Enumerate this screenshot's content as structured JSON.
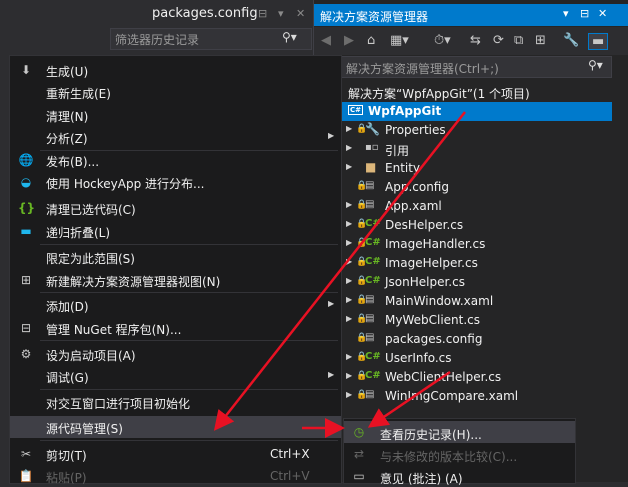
{
  "doc_tab": {
    "title": "packages.config",
    "pin": "⊟",
    "dropdown": "▾",
    "close": "✕"
  },
  "filter": {
    "placeholder": "筛选器历史记录",
    "icon": "⚲▾"
  },
  "context_menu": {
    "items": [
      {
        "label": "生成(U)",
        "icon": "build-icon",
        "glyph": "⬇"
      },
      {
        "label": "重新生成(E)"
      },
      {
        "label": "清理(N)"
      },
      {
        "label": "分析(Z)",
        "submenu": true
      },
      {
        "label": "发布(B)...",
        "icon": "globe-icon",
        "glyph": "🌐"
      },
      {
        "label": "使用 HockeyApp 进行分布...",
        "icon": "hockeyapp-icon",
        "glyph": "◒"
      },
      {
        "label": "清理已选代码(C)",
        "icon": "braces-icon",
        "glyph": "{}"
      },
      {
        "label": "递归折叠(L)",
        "icon": "collapse-icon",
        "glyph": "▬"
      },
      {
        "label": "限定为此范围(S)"
      },
      {
        "label": "新建解决方案资源管理器视图(N)",
        "icon": "new-view-icon",
        "glyph": "⊞"
      },
      {
        "label": "添加(D)",
        "submenu": true
      },
      {
        "label": "管理 NuGet 程序包(N)...",
        "icon": "nuget-icon",
        "glyph": "⊟"
      },
      {
        "label": "设为启动项目(A)",
        "icon": "gear-icon",
        "glyph": "⚙"
      },
      {
        "label": "调试(G)",
        "submenu": true
      },
      {
        "label": "对交互窗口进行项目初始化"
      },
      {
        "label": "源代码管理(S)",
        "submenu": true,
        "highlighted": true
      },
      {
        "label": "剪切(T)",
        "icon": "scissors-icon",
        "glyph": "✂",
        "shortcut": "Ctrl+X"
      },
      {
        "label": "粘贴(P)",
        "icon": "paste-icon",
        "glyph": "📋",
        "shortcut": "Ctrl+V",
        "disabled": true
      }
    ]
  },
  "solution_explorer": {
    "title": "解决方案资源管理器",
    "title_buttons": [
      "▾",
      "⊟",
      "✕"
    ],
    "toolbar": [
      "◀",
      "▶",
      "⌂",
      "▦▾",
      "⏱▾",
      "⇆",
      "⟳",
      "⧉",
      "⊞",
      "🔧",
      "▬"
    ],
    "search_placeholder": "解决方案资源管理器(Ctrl+;)",
    "search_icon": "⚲▾",
    "tree": [
      {
        "label": "解决方案“WpfAppGit”(1 个项目)",
        "indent": 0,
        "kind": "solution"
      },
      {
        "label": "WpfAppGit",
        "indent": 0,
        "kind": "project",
        "selected": true
      },
      {
        "label": "Properties",
        "indent": 1,
        "kind": "wrench",
        "expandable": true,
        "locked": true
      },
      {
        "label": "引用",
        "indent": 1,
        "kind": "refs",
        "expandable": true
      },
      {
        "label": "Entity",
        "indent": 1,
        "kind": "folder",
        "expandable": true
      },
      {
        "label": "App.config",
        "indent": 1,
        "kind": "config",
        "locked": true
      },
      {
        "label": "App.xaml",
        "indent": 1,
        "kind": "xaml",
        "expandable": true,
        "locked": true
      },
      {
        "label": "DesHelper.cs",
        "indent": 1,
        "kind": "cs",
        "expandable": true,
        "locked": true
      },
      {
        "label": "ImageHandler.cs",
        "indent": 1,
        "kind": "cs",
        "expandable": true,
        "locked": true
      },
      {
        "label": "ImageHelper.cs",
        "indent": 1,
        "kind": "cs",
        "expandable": true,
        "locked": true
      },
      {
        "label": "JsonHelper.cs",
        "indent": 1,
        "kind": "cs",
        "expandable": true,
        "locked": true
      },
      {
        "label": "MainWindow.xaml",
        "indent": 1,
        "kind": "xaml",
        "expandable": true,
        "locked": true
      },
      {
        "label": "MyWebClient.cs",
        "indent": 1,
        "kind": "cs",
        "expandable": true,
        "locked": true
      },
      {
        "label": "packages.config",
        "indent": 1,
        "kind": "config",
        "locked": true
      },
      {
        "label": "UserInfo.cs",
        "indent": 1,
        "kind": "cs",
        "expandable": true,
        "locked": true
      },
      {
        "label": "WebClientHelper.cs",
        "indent": 1,
        "kind": "cs",
        "expandable": true,
        "locked": true
      },
      {
        "label": "WinImgCompare.xaml",
        "indent": 1,
        "kind": "xaml",
        "expandable": true,
        "locked": true
      }
    ]
  },
  "submenu": {
    "items": [
      {
        "label": "查看历史记录(H)...",
        "icon": "history-icon",
        "glyph": "◷",
        "highlighted": true
      },
      {
        "label": "与未修改的版本比较(C)...",
        "icon": "compare-icon",
        "glyph": "⇄",
        "disabled": true
      },
      {
        "label": "意见 (批注) (A)",
        "icon": "annotate-icon",
        "glyph": "▭"
      }
    ]
  },
  "colors": {
    "accent": "#007acc",
    "arrow": "#e81123",
    "menu_bg": "#1b1b1c",
    "highlight": "#3f3f46",
    "cs_icon": "#68b723"
  }
}
